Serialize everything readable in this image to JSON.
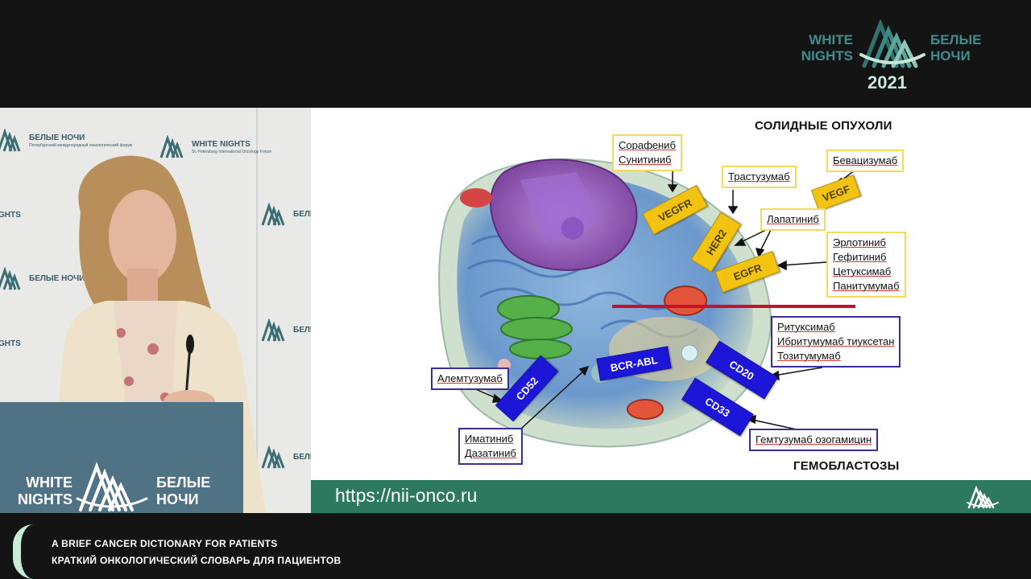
{
  "brand": {
    "left_line1": "WHITE",
    "left_line2": "NIGHTS",
    "right_line1": "БЕЛЫЕ",
    "right_line2": "НОЧИ",
    "year": "2021",
    "mark_icon": "white-nights-logo-icon"
  },
  "video": {
    "backdrop_labels": {
      "ru": "БЕЛЫЕ НОЧИ",
      "en": "WHITE NIGHTS",
      "ru_partial": "БЕЛЫЕ",
      "en_partial": "NIGHTS",
      "subtitle_ru": "Петербургский международный онкологический форум",
      "subtitle_en": "St. Petersburg International Oncology Forum"
    },
    "podium": {
      "left_line1": "WHITE",
      "left_line2": "NIGHTS",
      "right_line1": "БЕЛЫЕ",
      "right_line2": "НОЧИ"
    }
  },
  "slide": {
    "title_top": "СОЛИДНЫЕ ОПУХОЛИ",
    "title_bottom": "ГЕМОБЛАСТОЗЫ",
    "receptors": {
      "vegfr": "VEGFR",
      "her2": "HER2",
      "egfr": "EGFR",
      "vegf": "VEGF",
      "bcr_abl": "BCR-ABL",
      "cd52": "CD52",
      "cd20": "CD20",
      "cd33": "CD33"
    },
    "drugs": {
      "vegfr": [
        "Сорафениб",
        "Сунитиниб"
      ],
      "her2": [
        "Трастузумаб"
      ],
      "vegf": [
        "Бевацизумаб"
      ],
      "her2_egfr": [
        "Лапатиниб"
      ],
      "egfr": [
        "Эрлотиниб",
        "Гефитиниб",
        "Цетуксимаб",
        "Панитумумаб"
      ],
      "cd20": [
        "Ритуксимаб",
        "Ибритумумаб тиуксетан",
        "Тозитумумаб"
      ],
      "cd52": [
        "Алемтузумаб"
      ],
      "bcr_abl": [
        "Иматиниб",
        "Дазатиниб"
      ],
      "cd33": [
        "Гемтузумаб озогамицин"
      ]
    },
    "colors": {
      "solid_border": "#f3d95e",
      "hemo_border": "#3a2f98",
      "divider": "#c8102e",
      "receptor_yellow": "#f2c311",
      "receptor_blue": "#1d16d8"
    }
  },
  "footer": {
    "url": "https://nii-onco.ru",
    "bar_color": "#2c7960",
    "mark_icon": "white-nights-logo-icon"
  },
  "caption": {
    "line_en": "A BRIEF CANCER DICTIONARY FOR PATIENTS",
    "line_ru": "КРАТКИЙ ОНКОЛОГИЧЕСКИЙ СЛОВАРЬ ДЛЯ ПАЦИЕНТОВ"
  }
}
